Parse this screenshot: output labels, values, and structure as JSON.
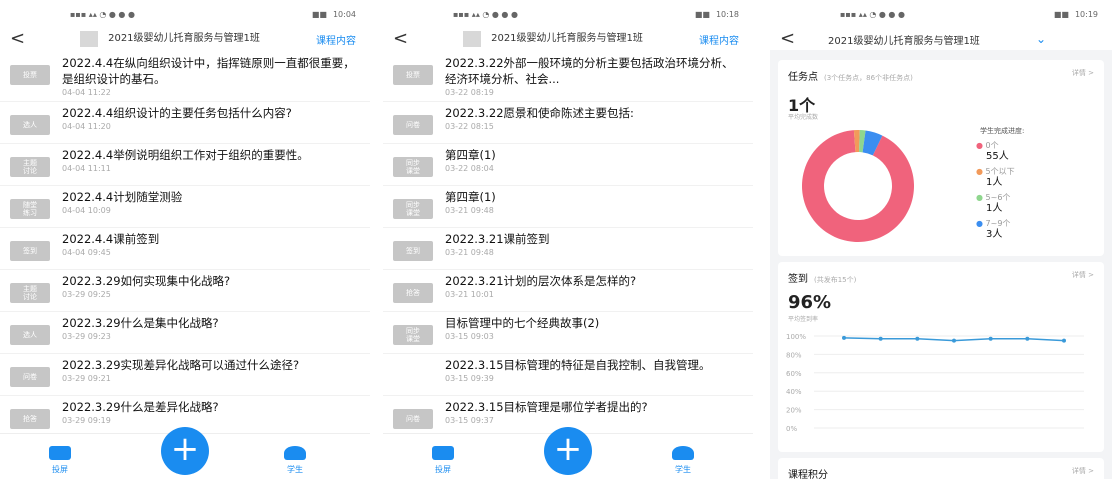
{
  "status": {
    "time1": "10:04",
    "time2": "10:18",
    "time3": "10:19",
    "battery": "■■"
  },
  "header": {
    "back": "<",
    "class_name": "2021级婴幼儿托育服务与管理1班",
    "course_link": "课程内容",
    "dropdown": "⌄"
  },
  "screen1": {
    "items": [
      {
        "badge": "投票",
        "title": "2022.4.4在纵向组织设计中，指挥链原则一直都很重要，是组织设计的基石。",
        "time": "04-04 11:22"
      },
      {
        "badge": "选人",
        "title": "2022.4.4组织设计的主要任务包括什么内容?",
        "time": "04-04 11:20"
      },
      {
        "badge": "主题\n讨论",
        "title": "2022.4.4举例说明组织工作对于组织的重要性。",
        "time": "04-04 11:11"
      },
      {
        "badge": "随堂\n练习",
        "title": "2022.4.4计划随堂测验",
        "time": "04-04 10:09"
      },
      {
        "badge": "签到",
        "title": "2022.4.4课前签到",
        "time": "04-04 09:45"
      },
      {
        "badge": "主题\n讨论",
        "title": "2022.3.29如何实现集中化战略?",
        "time": "03-29 09:25"
      },
      {
        "badge": "选人",
        "title": "2022.3.29什么是集中化战略?",
        "time": "03-29 09:23"
      },
      {
        "badge": "问卷",
        "title": "2022.3.29实现差异化战略可以通过什么途径?",
        "time": "03-29 09:21"
      },
      {
        "badge": "抢答",
        "title": "2022.3.29什么是差异化战略?",
        "time": "03-29 09:19"
      }
    ]
  },
  "screen2": {
    "items": [
      {
        "badge": "投票",
        "title": "2022.3.22外部一般环境的分析主要包括政治环境分析、经济环境分析、社会...",
        "time": "03-22 08:19"
      },
      {
        "badge": "问卷",
        "title": "2022.3.22愿景和使命陈述主要包括:",
        "time": "03-22 08:15"
      },
      {
        "badge": "同步\n课堂",
        "title": "第四章(1)",
        "time": "03-22 08:04"
      },
      {
        "badge": "同步\n课堂",
        "title": "第四章(1)",
        "time": "03-21 09:48"
      },
      {
        "badge": "签到",
        "title": "2022.3.21课前签到",
        "time": "03-21 09:48"
      },
      {
        "badge": "抢答",
        "title": "2022.3.21计划的层次体系是怎样的?",
        "time": "03-21 10:01"
      },
      {
        "badge": "同步\n课堂",
        "title": "目标管理中的七个经典故事(2)",
        "time": "03-15 09:03"
      },
      {
        "badge": "",
        "title": "2022.3.15目标管理的特征是自我控制、自我管理。",
        "time": "03-15 09:39"
      },
      {
        "badge": "问卷",
        "title": "2022.3.15目标管理是哪位学者提出的?",
        "time": "03-15 09:37"
      }
    ]
  },
  "tabbar": {
    "tab1": "投屏",
    "plus": "+",
    "tab2": "学生"
  },
  "screen3": {
    "task_card": {
      "title": "任务点",
      "subtitle": "(3个任务点，86个非任务点)",
      "detail": "详情 >",
      "big_value": "1个",
      "big_label": "平均完成数",
      "legend_title": "学生完成进度:",
      "legend": [
        {
          "label": "0个",
          "count": "55人",
          "color": "#f0637c"
        },
        {
          "label": "5个以下",
          "count": "1人",
          "color": "#f29a5a"
        },
        {
          "label": "5~6个",
          "count": "1人",
          "color": "#8fd68e"
        },
        {
          "label": "7~9个",
          "count": "3人",
          "color": "#3b8ef0"
        }
      ]
    },
    "signin_card": {
      "title": "签到",
      "subtitle": "(共发布15个)",
      "detail": "详情 >",
      "big_value": "96%",
      "big_label": "平均签到率",
      "yticks": [
        "100%",
        "80%",
        "60%",
        "40%",
        "20%",
        "0%"
      ]
    },
    "score_card": {
      "title": "课程积分",
      "detail": "详情 >"
    }
  },
  "chart_data": [
    {
      "type": "pie",
      "title": "学生完成进度",
      "categories": [
        "0个",
        "5个以下",
        "5~6个",
        "7~9个"
      ],
      "values": [
        55,
        1,
        1,
        3
      ],
      "colors": [
        "#f0637c",
        "#f29a5a",
        "#8fd68e",
        "#3b8ef0"
      ]
    },
    {
      "type": "line",
      "title": "签到",
      "x": [
        1,
        2,
        3,
        4,
        5,
        6,
        7
      ],
      "series": [
        {
          "name": "",
          "values": [
            98,
            97,
            97,
            95,
            97,
            97,
            95
          ]
        }
      ],
      "ylim": [
        0,
        100
      ],
      "yticks": [
        "100%",
        "80%",
        "60%",
        "40%",
        "20%",
        "0%"
      ],
      "grid": true
    }
  ]
}
